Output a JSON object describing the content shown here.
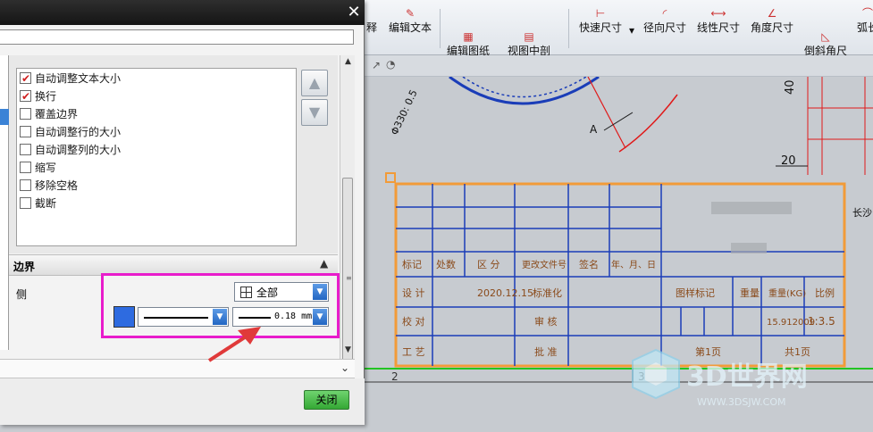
{
  "toolbar": {
    "buttons": [
      {
        "label": "释"
      },
      {
        "label": "编辑文本"
      },
      {
        "label": "编辑图纸\n页"
      },
      {
        "label": "视图中剖\n切"
      },
      {
        "label": "快速尺寸"
      },
      {
        "label": "径向尺寸"
      },
      {
        "label": "线性尺寸"
      },
      {
        "label": "角度尺寸"
      },
      {
        "label": "倒斜角尺\n寸"
      },
      {
        "label": "弧长"
      }
    ]
  },
  "drawing": {
    "dim_phi": "Φ330: 0.5",
    "dim_a": "A",
    "dim_40": "40",
    "dim_20": "20",
    "zone_2": "2",
    "zone_3": "3",
    "title_block": {
      "header": [
        "标记",
        "处数",
        "区 分",
        "更改文件号",
        "签名",
        "年、月、日"
      ],
      "row_design": [
        "设 计",
        "2020.12.15",
        "标准化",
        "图样标记",
        "重量",
        "重量(KG)",
        "比例"
      ],
      "row_check": [
        "校 对",
        "审 核",
        "15.912009",
        "1:3.5"
      ],
      "row_craft": [
        "工 艺",
        "批 准",
        "第1页",
        "共1页"
      ],
      "right_text": "长沙"
    }
  },
  "watermark": {
    "brand": "3D世界网",
    "url": "WWW.3DSJW.COM"
  },
  "dialog": {
    "close_glyph": "✕",
    "name_value": "",
    "options": [
      {
        "label": "自动调整文本大小",
        "checked": true
      },
      {
        "label": "换行",
        "checked": true
      },
      {
        "label": "覆盖边界",
        "checked": false
      },
      {
        "label": "自动调整行的大小",
        "checked": false
      },
      {
        "label": "自动调整列的大小",
        "checked": false
      },
      {
        "label": "缩写",
        "checked": false
      },
      {
        "label": "移除空格",
        "checked": false
      },
      {
        "label": "截断",
        "checked": false
      }
    ],
    "border_section": {
      "title": "边界",
      "side_label": "侧",
      "side_select": "全部",
      "color": "#2e6be0",
      "line_width": "0.18 mm"
    },
    "close_button": "关闭"
  }
}
